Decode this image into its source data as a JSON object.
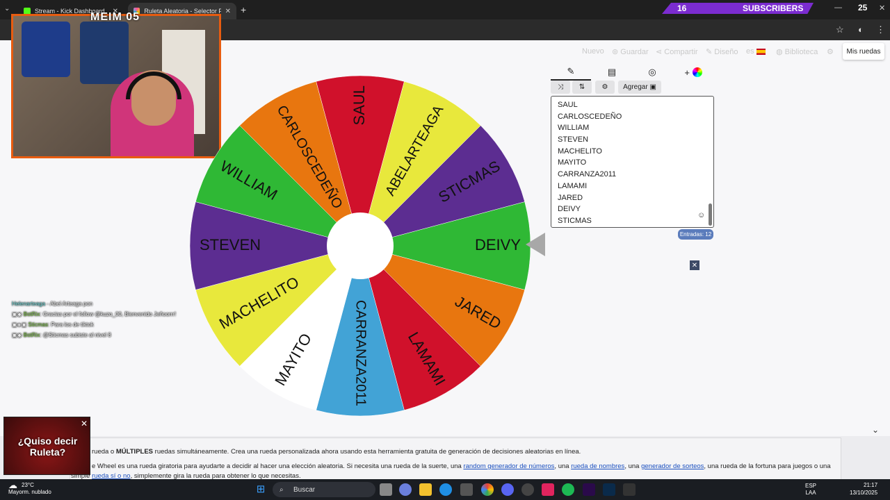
{
  "browser": {
    "tabs": [
      {
        "title": "Stream - Kick Dashboard",
        "icon": "kick-icon",
        "color": "#53fc18"
      },
      {
        "title": "Ruleta Aleatoria - Selector Pers",
        "icon": "wheel-icon",
        "color": "#ff4f9a"
      }
    ],
    "subscriber_banner": {
      "count": "16",
      "label": "SUBSCRIBERS",
      "right_count": "25"
    }
  },
  "webcam": {
    "title": "MEIM 05"
  },
  "toolbar": {
    "nuevo": "Nuevo",
    "guardar": "Guardar",
    "compartir": "Compartir",
    "diseno": "Diseño",
    "lang": "es",
    "biblioteca": "Biblioteca",
    "mis_ruedas": "Mis ruedas"
  },
  "wheel": {
    "segments": [
      {
        "label": "SAUL",
        "color": "#d0112b"
      },
      {
        "label": "ABELARTEAGA",
        "color": "#e8e83c"
      },
      {
        "label": "STICMAS",
        "color": "#5c2d91"
      },
      {
        "label": "DEIVY",
        "color": "#2fb835"
      },
      {
        "label": "JARED",
        "color": "#e8760f"
      },
      {
        "label": "LAMAMI",
        "color": "#d0112b"
      },
      {
        "label": "CARRANZA2011",
        "color": "#42a3d6"
      },
      {
        "label": "MAYITO",
        "color": "#ffffff"
      },
      {
        "label": "MACHELITO",
        "color": "#e8e83c"
      },
      {
        "label": "STEVEN",
        "color": "#5c2d91"
      },
      {
        "label": "WILLIAM",
        "color": "#2fb835"
      },
      {
        "label": "CARLOSCEDEÑO",
        "color": "#e8760f"
      }
    ],
    "start_angle_deg": -105
  },
  "editor": {
    "add_label": "Agregar",
    "entries": [
      "SAUL",
      "CARLOSCEDEÑO",
      "WILLIAM",
      "STEVEN",
      "MACHELITO",
      "MAYITO",
      "CARRANZA2011",
      "LAMAMI",
      "JARED",
      "DEIVY",
      "STICMAS"
    ],
    "count_label": "Entradas: 12"
  },
  "chat": [
    {
      "user": "Helenarteaga",
      "msg": "- Abel Arteaga pon"
    },
    {
      "user": "BotRix",
      "msg": ": Gracias por el follow @kuzo_00, Bienvenido Jeñoorrr!"
    },
    {
      "user": "Sticmas",
      "msg": ": Para los de tiktok"
    },
    {
      "user": "BotRix",
      "msg": ": @Sticmas subiste al nivel 8"
    }
  ],
  "page": {
    "line1_pre": "rueda o ",
    "line1_bold": "MÚLTIPLES",
    "line1_post": " ruedas simultáneamente. Crea una rueda personalizada ahora usando esta herramienta gratuita de generación de decisiones aleatorias en línea.",
    "line2_a": "e Wheel es una rueda giratoria para ayudarte a decidir al hacer una elección aleatoria. Si necesita una rueda de la suerte, una ",
    "link1": "random generador de números",
    "line2_b": ", una ",
    "link2": "rueda de nombres",
    "line2_c": ", una ",
    "link3": "generador de sorteos",
    "line2_d": ", una rueda de la fortuna para juegos o una",
    "line3_a": "simple ",
    "link4": "rueda sí o no",
    "line3_b": ", simplemente gira la rueda para obtener lo que necesitas."
  },
  "popup": {
    "title": "¿Quiso decir Ruleta?"
  },
  "taskbar": {
    "temp": "23°C",
    "weather": "Mayorm. nublado",
    "search": "Buscar",
    "lang1": "ESP",
    "lang2": "LAA",
    "time": "21:17",
    "date": "13/10/2025"
  }
}
